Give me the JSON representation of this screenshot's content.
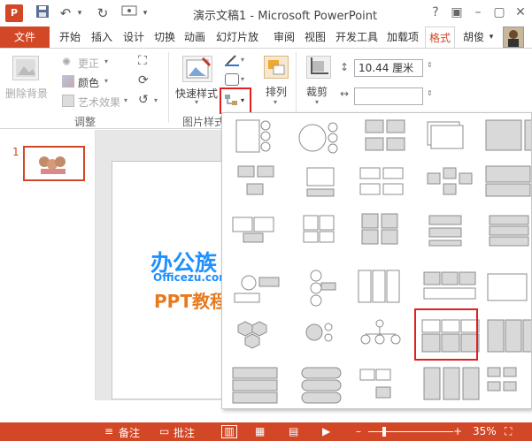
{
  "window": {
    "title": "演示文稿1 - Microsoft PowerPoint",
    "help": "?",
    "logo": "P"
  },
  "tabs": [
    {
      "label": "文件"
    },
    {
      "label": "开始"
    },
    {
      "label": "插入"
    },
    {
      "label": "设计"
    },
    {
      "label": "切换"
    },
    {
      "label": "动画"
    },
    {
      "label": "幻灯片放"
    },
    {
      "label": "审阅"
    },
    {
      "label": "视图"
    },
    {
      "label": "开发工具"
    },
    {
      "label": "加载项"
    },
    {
      "label": "格式"
    }
  ],
  "user": {
    "name": "胡俊"
  },
  "ribbon": {
    "remove_background": "删除背景",
    "corrections": "更正",
    "color": "颜色",
    "artistic_effects": "艺术效果",
    "adjust_group": "调整",
    "quick_styles": "快速样式",
    "picture_styles_group": "图片样式",
    "arrange": "排列",
    "crop": "裁剪",
    "height_value": "10.44 厘米"
  },
  "slides": [
    {
      "number": "1"
    }
  ],
  "watermark": {
    "brand": "办公族",
    "site": "Officezu.com",
    "tag": "PPT教程"
  },
  "status": {
    "notes": "备注",
    "comments": "批注",
    "zoom": "35%"
  },
  "gallery": {
    "name": "picture-layout-gallery",
    "selected_index": 23,
    "columns": 5,
    "rows": 7
  },
  "colors": {
    "accent": "#d24726",
    "highlight": "#e02020",
    "shape_fill": "#d9d9d9"
  },
  "icons": [
    "undo-icon",
    "redo-icon",
    "save-icon",
    "picture-layout-icon",
    "crop-icon"
  ]
}
